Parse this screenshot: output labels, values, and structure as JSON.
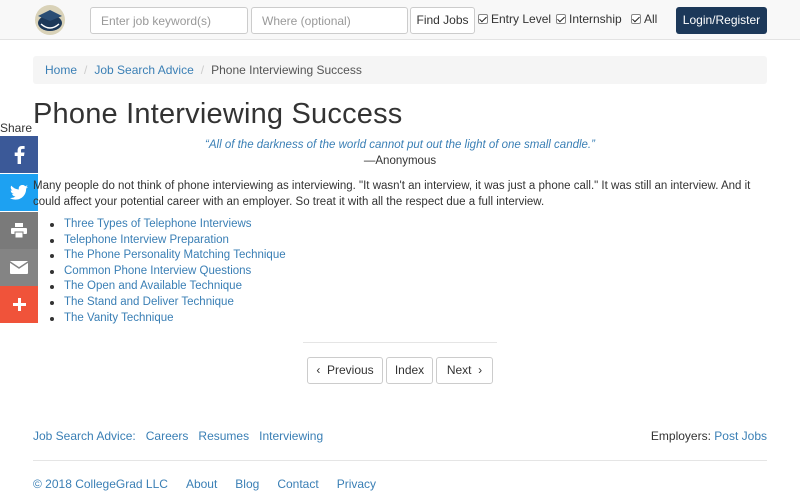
{
  "header": {
    "logo_icon": "graduation-cap-logo-icon",
    "keyword_placeholder": "Enter job keyword(s)",
    "location_placeholder": "Where (optional)",
    "find_label": "Find Jobs",
    "filters": [
      {
        "label": "Entry Level",
        "checked": true
      },
      {
        "label": "Internship",
        "checked": true
      },
      {
        "label": "All",
        "checked": true
      }
    ],
    "login_label": "Login/Register",
    "login_color": "#1c3859"
  },
  "breadcrumb": [
    "Home",
    "Job Search Advice",
    "Phone Interviewing Success"
  ],
  "share": {
    "label": "Share",
    "buttons": [
      {
        "icon": "facebook-icon",
        "color": "#3b5998"
      },
      {
        "icon": "twitter-icon",
        "color": "#1da1f2"
      },
      {
        "icon": "print-icon",
        "color": "#7a7a7a"
      },
      {
        "icon": "email-icon",
        "color": "#848484"
      },
      {
        "icon": "plus-icon",
        "color": "#f0533a"
      }
    ]
  },
  "article": {
    "title": "Phone Interviewing Success",
    "quote": "“All of the darkness of the world cannot put out the light of one small candle.”",
    "author": "—Anonymous",
    "intro": "Many people do not think of phone interviewing as interviewing. \"It wasn't an interview, it was just a phone call.\" It was still an interview. And it could affect your potential career with an employer. So treat it with all the respect due a full interview.",
    "links": [
      "Three Types of Telephone Interviews",
      "Telephone Interview Preparation",
      "The Phone Personality Matching Technique",
      "Common Phone Interview Questions",
      "The Open and Available Technique",
      "The Stand and Deliver Technique",
      "The Vanity Technique"
    ]
  },
  "pager": {
    "previous": "Previous",
    "index": "Index",
    "next": "Next"
  },
  "footer": {
    "advice_label": "Job Search Advice:",
    "advice_links": [
      "Careers",
      "Resumes",
      "Interviewing"
    ],
    "employers_label": "Employers:",
    "employers_link": "Post Jobs",
    "copyright": "© 2018 CollegeGrad LLC",
    "bottom_links": [
      "About",
      "Blog",
      "Contact",
      "Privacy"
    ]
  }
}
